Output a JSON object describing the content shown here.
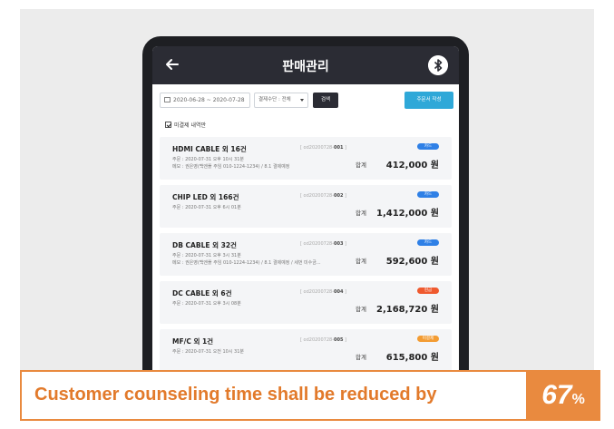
{
  "header": {
    "title": "판매관리",
    "back_icon": "arrow-left-icon",
    "bluetooth_icon": "bluetooth-icon"
  },
  "filter": {
    "date_range": "2020-06-28 ~ 2020-07-28",
    "payment_select": "결제수단 : 전체",
    "search_label": "검색",
    "create_order_label": "주문서 작성"
  },
  "unpaid_only_label": "미결제 내역만",
  "orders": [
    {
      "title": "HDMI CABLE 외 16건",
      "order_prefix": "[ od20200728-",
      "order_num": "001",
      "order_suffix": " ]",
      "date": "주문 : 2020-07-31 오후 10시 31분",
      "memo": "메모 : 권은영(백엔플 주임 010-1224-1234) / 8.1 결제예정",
      "badge": "카드",
      "badge_color": "#2f80e6",
      "sum_label": "합계",
      "amount": "412,000 원"
    },
    {
      "title": "CHIP LED 외 166건",
      "order_prefix": "[ od20200728-",
      "order_num": "002",
      "order_suffix": " ]",
      "date": "주문 : 2020-07-31 오후 6시 01분",
      "memo": "",
      "badge": "카드",
      "badge_color": "#2f80e6",
      "sum_label": "합계",
      "amount": "1,412,000 원"
    },
    {
      "title": "DB CABLE 외 32건",
      "order_prefix": "[ od20200728-",
      "order_num": "003",
      "order_suffix": " ]",
      "date": "주문 : 2020-07-31 오후 3시 31분",
      "memo": "메모 : 권은영(백엔플 주임 010-1224-1234) / 8.1 결제예정 / 세번 미수금...",
      "badge": "카드",
      "badge_color": "#2f80e6",
      "sum_label": "합계",
      "amount": "592,600 원"
    },
    {
      "title": "DC CABLE 외 6건",
      "order_prefix": "[ od20200728-",
      "order_num": "004",
      "order_suffix": " ]",
      "date": "주문 : 2020-07-31 오후 3시 08분",
      "memo": "",
      "badge": "현금",
      "badge_color": "#ef5a2f",
      "sum_label": "합계",
      "amount": "2,168,720 원"
    },
    {
      "title": "MF/C 외 1건",
      "order_prefix": "[ od20200728-",
      "order_num": "005",
      "order_suffix": " ]",
      "date": "주문 : 2020-07-31 오전 10시 31분",
      "memo": "",
      "badge": "미결제",
      "badge_color": "#f39c33",
      "sum_label": "합계",
      "amount": "615,800 원"
    }
  ],
  "banner": {
    "text": "Customer counseling time shall be reduced by",
    "percent_value": "67",
    "percent_sign": "%",
    "color": "#e98a3f"
  }
}
